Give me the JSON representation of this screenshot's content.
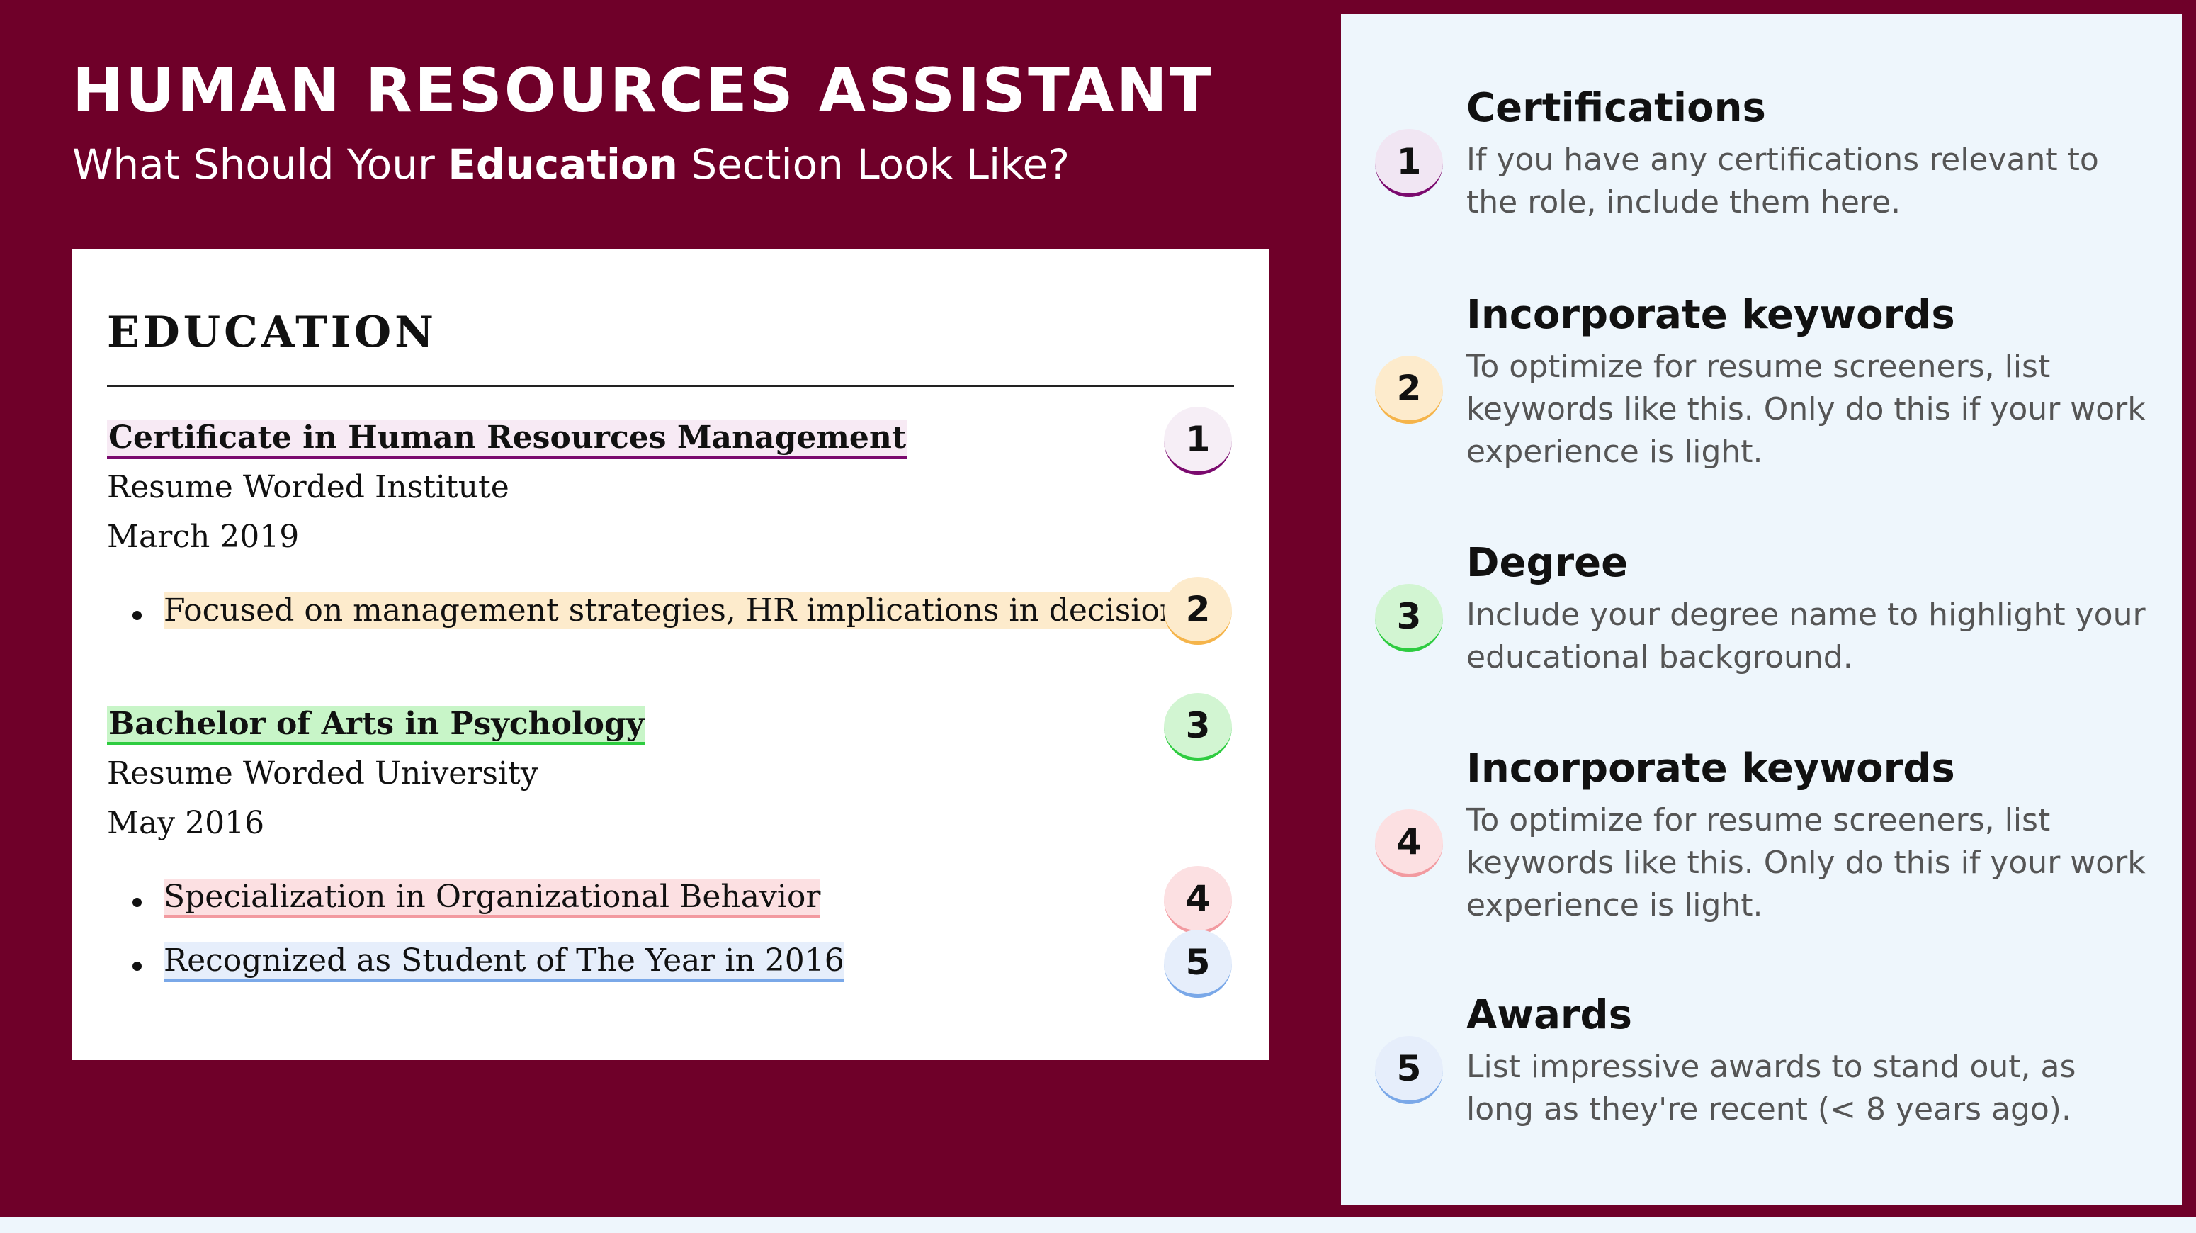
{
  "header": {
    "title": "HUMAN RESOURCES ASSISTANT",
    "subtitle_pre": "What Should Your ",
    "subtitle_bold": "Education",
    "subtitle_post": " Section Look Like?"
  },
  "resume": {
    "heading": "EDUCATION",
    "entries": [
      {
        "degree": "Certificate in Human Resources Management",
        "school": "Resume Worded Institute",
        "date": "March 2019",
        "bullets": [
          "Focused on management strategies, HR implications in decision making"
        ]
      },
      {
        "degree": "Bachelor of Arts in Psychology",
        "school": "Resume Worded University",
        "date": "May 2016",
        "bullets": [
          "Specialization in Organizational Behavior",
          "Recognized as Student of The Year in 2016"
        ]
      }
    ],
    "markers": [
      "1",
      "2",
      "3",
      "4",
      "5"
    ]
  },
  "tips": [
    {
      "number": "1",
      "title": "Certifications",
      "desc": "If you have any certifications relevant to the role, include them here."
    },
    {
      "number": "2",
      "title": "Incorporate keywords",
      "desc": "To optimize for resume screeners, list keywords like this. Only do this if your work experience is light."
    },
    {
      "number": "3",
      "title": "Degree",
      "desc": "Include your degree name to highlight your educational background."
    },
    {
      "number": "4",
      "title": "Incorporate keywords",
      "desc": "To optimize for resume screeners, list keywords like this. Only do this if your work experience is light."
    },
    {
      "number": "5",
      "title": "Awards",
      "desc": "List impressive awards to stand out, as long as they're recent (< 8 years ago)."
    }
  ],
  "colors": {
    "background": "#6f0029",
    "panel": "#eef6fc",
    "marker1": "#7b0a6e",
    "marker2": "#f5b44a",
    "marker3": "#2ecc40",
    "marker4": "#f29aa0",
    "marker5": "#7aa8e8"
  }
}
